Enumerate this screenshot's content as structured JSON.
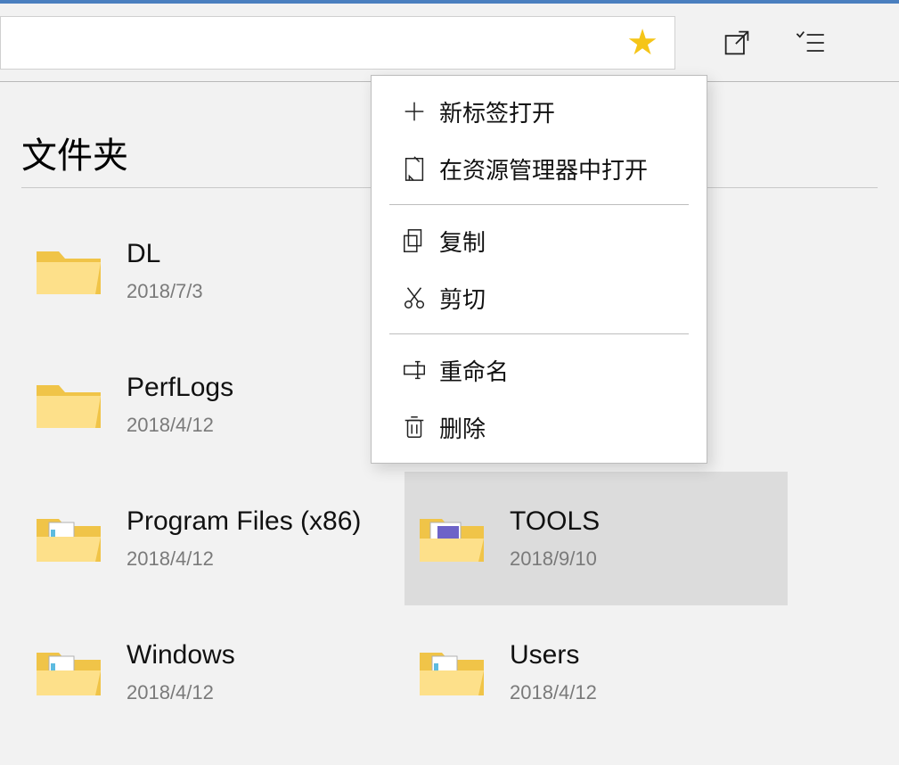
{
  "toolbar": {
    "address_value": "",
    "favorite": true
  },
  "section": {
    "title": "文件夹"
  },
  "folders": [
    {
      "name": "DL",
      "date": "2018/7/3",
      "icon": "plain",
      "selected": false
    },
    {
      "name": "",
      "date": "",
      "icon": "",
      "selected": false
    },
    {
      "name": "PerfLogs",
      "date": "2018/4/12",
      "icon": "plain",
      "selected": false
    },
    {
      "name": "",
      "date": "",
      "icon": "",
      "selected": false
    },
    {
      "name": "Program Files (x86)",
      "date": "2018/4/12",
      "icon": "docs",
      "selected": false
    },
    {
      "name": "TOOLS",
      "date": "2018/9/10",
      "icon": "thumb",
      "selected": true
    },
    {
      "name": "Windows",
      "date": "2018/4/12",
      "icon": "docs",
      "selected": false
    },
    {
      "name": "Users",
      "date": "2018/4/12",
      "icon": "docs",
      "selected": false
    }
  ],
  "context_menu": {
    "groups": [
      [
        {
          "icon": "plus-icon",
          "label": "新标签打开"
        },
        {
          "icon": "explorer-icon",
          "label": "在资源管理器中打开"
        }
      ],
      [
        {
          "icon": "copy-icon",
          "label": "复制"
        },
        {
          "icon": "cut-icon",
          "label": "剪切"
        }
      ],
      [
        {
          "icon": "rename-icon",
          "label": "重命名"
        },
        {
          "icon": "delete-icon",
          "label": "删除"
        }
      ]
    ]
  }
}
